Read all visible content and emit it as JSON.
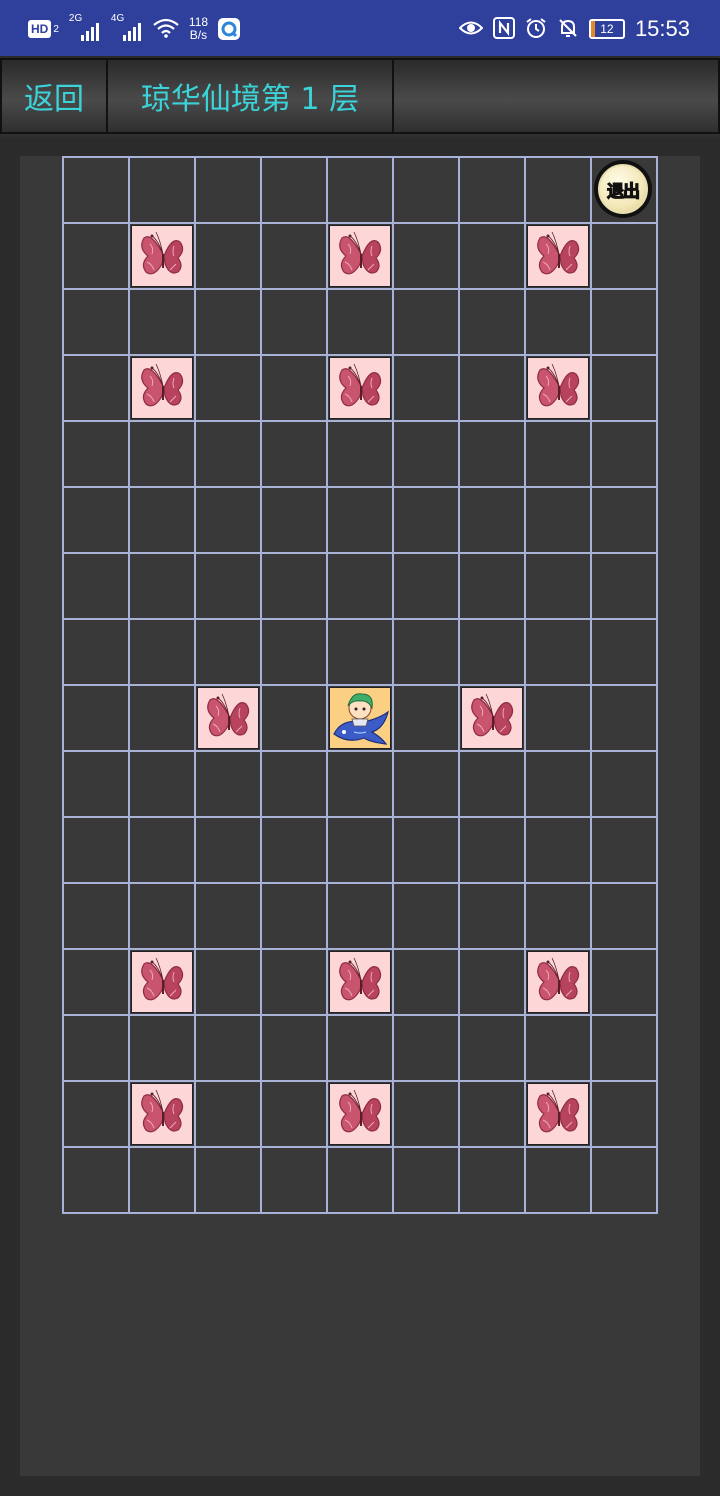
{
  "status_bar": {
    "hd_label": "HD",
    "hd_sub": "2",
    "sim1_tag": "2G",
    "sim2_tag": "4G",
    "speed_value": "118",
    "speed_unit": "B/s",
    "battery_level": "12",
    "battery_percent": 12,
    "time": "15:53",
    "icons": [
      "eye-icon",
      "nfc-icon",
      "alarm-icon",
      "mute-icon"
    ]
  },
  "toolbar": {
    "back_label": "返回",
    "title": "琼华仙境第 1 层"
  },
  "board": {
    "columns": 9,
    "rows": 16,
    "exit_label": "退出",
    "exit": {
      "row": 0,
      "col": 8
    },
    "player": {
      "row": 8,
      "col": 4
    },
    "butterflies": [
      {
        "row": 1,
        "col": 1
      },
      {
        "row": 1,
        "col": 4
      },
      {
        "row": 1,
        "col": 7
      },
      {
        "row": 3,
        "col": 1
      },
      {
        "row": 3,
        "col": 4
      },
      {
        "row": 3,
        "col": 7
      },
      {
        "row": 8,
        "col": 2
      },
      {
        "row": 8,
        "col": 6
      },
      {
        "row": 12,
        "col": 1
      },
      {
        "row": 12,
        "col": 4
      },
      {
        "row": 12,
        "col": 7
      },
      {
        "row": 14,
        "col": 1
      },
      {
        "row": 14,
        "col": 4
      },
      {
        "row": 14,
        "col": 7
      }
    ]
  },
  "colors": {
    "status_bg": "#2f3f9c",
    "accent_text": "#3ad3d9",
    "grid_line": "#a9b1d6",
    "butterfly_tile": "#fdd7d8",
    "player_tile": "#fbcf84"
  }
}
